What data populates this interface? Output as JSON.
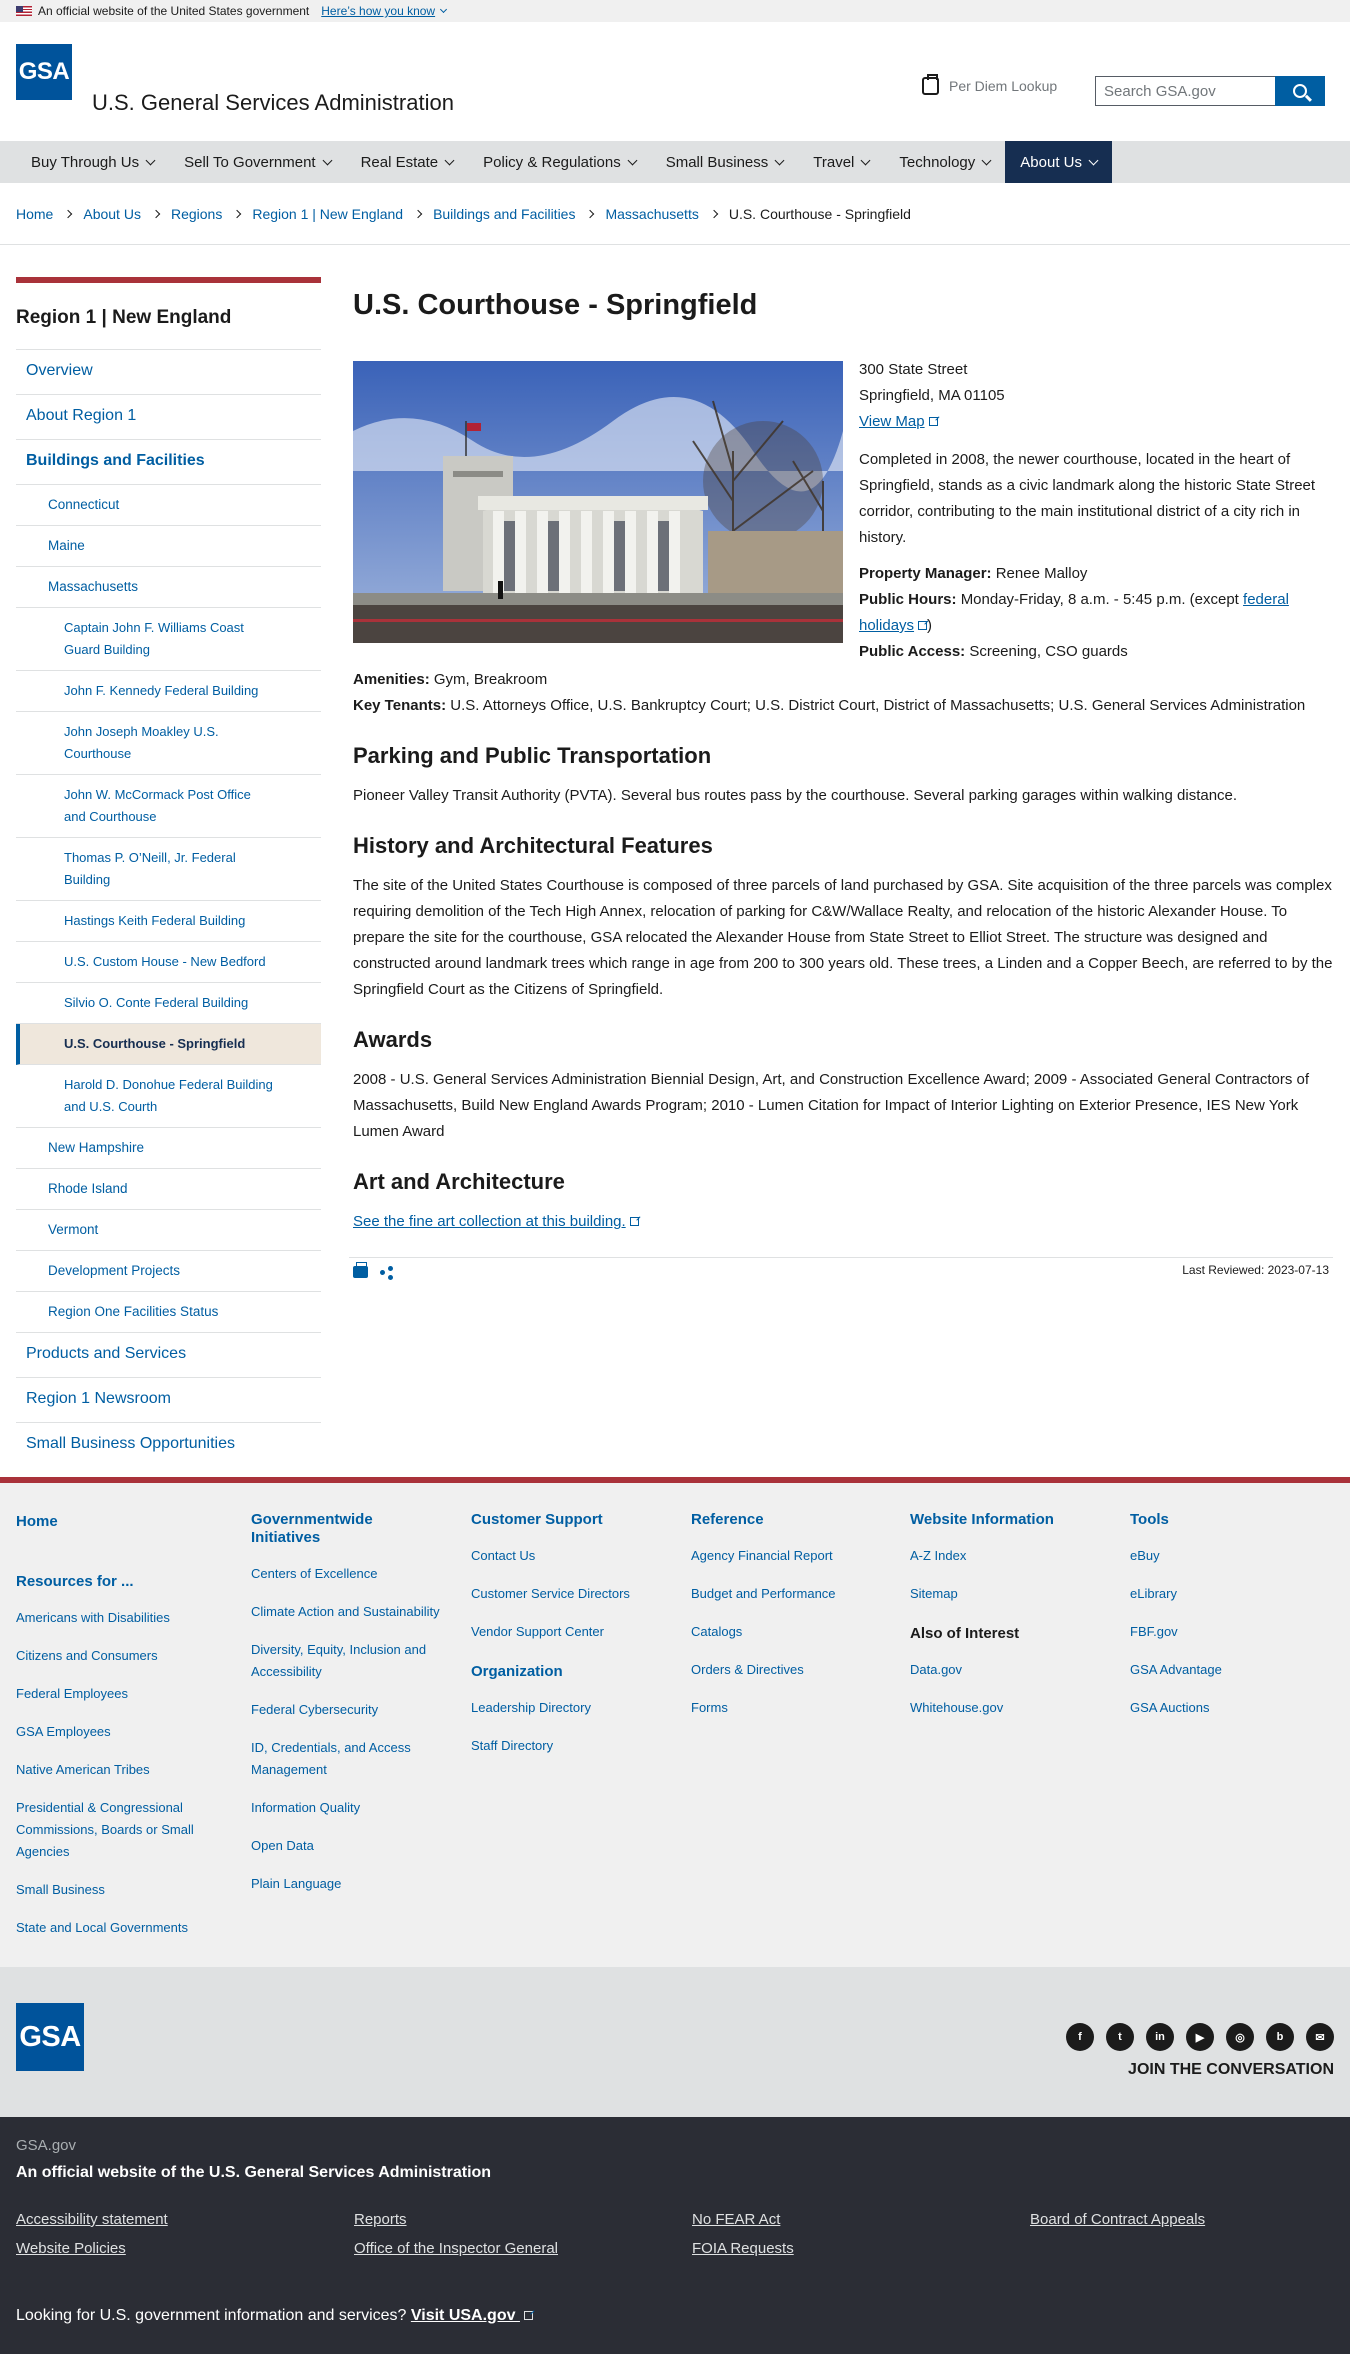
{
  "gov_banner": {
    "text": "An official website of the United States government",
    "link": "Here’s how you know"
  },
  "header": {
    "logo": "GSA",
    "site_name": "U.S. General Services Administration",
    "per_diem": "Per Diem Lookup",
    "search_placeholder": "Search GSA.gov"
  },
  "nav": [
    "Buy Through Us",
    "Sell To Government",
    "Real Estate",
    "Policy & Regulations",
    "Small Business",
    "Travel",
    "Technology",
    "About Us"
  ],
  "breadcrumb": [
    "Home",
    "About Us",
    "Regions",
    "Region 1 | New England",
    "Buildings and Facilities",
    "Massachusetts",
    "U.S. Courthouse - Springfield"
  ],
  "sidenav": {
    "title": "Region 1 | New England",
    "items": [
      "Overview",
      "About Region 1",
      "Buildings and Facilities",
      "Connecticut",
      "Maine",
      "Massachusetts",
      "Captain John F. Williams Coast Guard Building",
      "John F. Kennedy Federal Building",
      "John Joseph Moakley U.S. Courthouse",
      "John W. McCormack Post Office and Courthouse",
      "Thomas P. O’Neill, Jr. Federal Building",
      "Hastings Keith Federal Building",
      "U.S. Custom House - New Bedford",
      "Silvio O. Conte Federal Building",
      "U.S. Courthouse - Springfield",
      "Harold D. Donohue Federal Building and U.S. Courth",
      "New Hampshire",
      "Rhode Island",
      "Vermont",
      "Development Projects",
      "Region One Facilities Status",
      "Products and Services",
      "Region 1 Newsroom",
      "Small Business Opportunities"
    ]
  },
  "page": {
    "title": "U.S. Courthouse - Springfield",
    "street": "300 State Street",
    "city": "Springfield, MA 01105",
    "view_map": "View Map",
    "intro": "Completed in 2008, the newer courthouse, located in the heart of Springfield, stands as a civic landmark along the historic State Street corridor, contributing to the main institutional district of a city rich in history.",
    "manager_label": "Property Manager:",
    "manager": "Renee Malloy",
    "hours_label": "Public Hours:",
    "hours": "Monday-Friday, 8 a.m. - 5:45 p.m. (except",
    "hours_link": "federal holidays",
    "hours_end": ")",
    "access_label": "Public Access:",
    "access": "Screening, CSO guards",
    "amenities_label": "Amenities:",
    "amenities": "Gym, Breakroom",
    "tenants_label": "Key Tenants:",
    "tenants": "U.S. Attorneys Office, U.S. Bankruptcy Court; U.S. District Court, District of Massachusetts; U.S. General Services Administration",
    "parking_heading": "Parking and Public Transportation",
    "parking": "Pioneer Valley Transit Authority (PVTA). Several bus routes pass by the courthouse. Several parking garages within walking distance.",
    "history_heading": "History and Architectural Features",
    "history": "The site of the United States Courthouse is composed of three parcels of land purchased by GSA. Site acquisition of the three parcels was complex requiring demolition of the Tech High Annex, relocation of parking for C&W/Wallace Realty, and relocation of the historic Alexander House. To prepare the site for the courthouse, GSA relocated the Alexander House from State Street to Elliot Street. The structure was designed and constructed around landmark trees which range in age from 200 to 300 years old. These trees, a Linden and a Copper Beech, are referred to by the Springfield Court as the Citizens of Springfield.",
    "awards_heading": "Awards",
    "awards": "2008 - U.S. General Services Administration Biennial Design, Art, and Construction Excellence Award; 2009 - Associated General Contractors of Massachusetts, Build New England Awards Program; 2010 - Lumen Citation for Impact of Interior Lighting on Exterior Presence, IES New York Lumen Award",
    "art_heading": "Art and Architecture",
    "art_link": "See the fine art collection at this building.",
    "last_reviewed": "Last Reviewed: 2023-07-13"
  },
  "footer": {
    "col1": {
      "home": "Home",
      "resources": "Resources for ...",
      "links": [
        "Americans with Disabilities",
        "Citizens and Consumers",
        "Federal Employees",
        "GSA Employees",
        "Native American Tribes",
        "Presidential & Congressional Commissions, Boards or Small Agencies",
        "Small Business",
        "State and Local Governments"
      ]
    },
    "col2": {
      "heading": "Governmentwide Initiatives",
      "links": [
        "Centers of Excellence",
        "Climate Action and Sustainability",
        "Diversity, Equity, Inclusion and Accessibility",
        "Federal Cybersecurity",
        "ID, Credentials, and Access Management",
        "Information Quality",
        "Open Data",
        "Plain Language"
      ]
    },
    "col3": {
      "heading": "Customer Support",
      "links": [
        "Contact Us",
        "Customer Service Directors",
        "Vendor Support Center"
      ],
      "heading2": "Organization",
      "links2": [
        "Leadership Directory",
        "Staff Directory"
      ]
    },
    "col4": {
      "heading": "Reference",
      "links": [
        "Agency Financial Report",
        "Budget and Performance",
        "Catalogs",
        "Orders & Directives",
        "Forms"
      ]
    },
    "col5": {
      "heading": "Website Information",
      "links": [
        "A-Z Index",
        "Sitemap"
      ],
      "heading2": "Also of Interest",
      "links2": [
        "Data.gov",
        "Whitehouse.gov"
      ]
    },
    "col6": {
      "heading": "Tools",
      "links": [
        "eBuy",
        "eLibrary",
        "FBF.gov",
        "GSA Advantage",
        "GSA Auctions"
      ]
    },
    "join": "JOIN THE CONVERSATION",
    "socials": [
      "facebook-icon",
      "twitter-icon",
      "linkedin-icon",
      "youtube-icon",
      "instagram-icon",
      "blog-icon",
      "email-icon"
    ]
  },
  "identifier": {
    "domain": "GSA.gov",
    "official": "An official website of the U.S. General Services Administration",
    "links": [
      "Accessibility statement",
      "Reports",
      "No FEAR Act",
      "Board of Contract Appeals",
      "Website Policies",
      "Office of the Inspector General",
      "FOIA Requests"
    ],
    "usa_text": "Looking for U.S. government information and services?",
    "usa_link": "Visit USA.gov"
  }
}
